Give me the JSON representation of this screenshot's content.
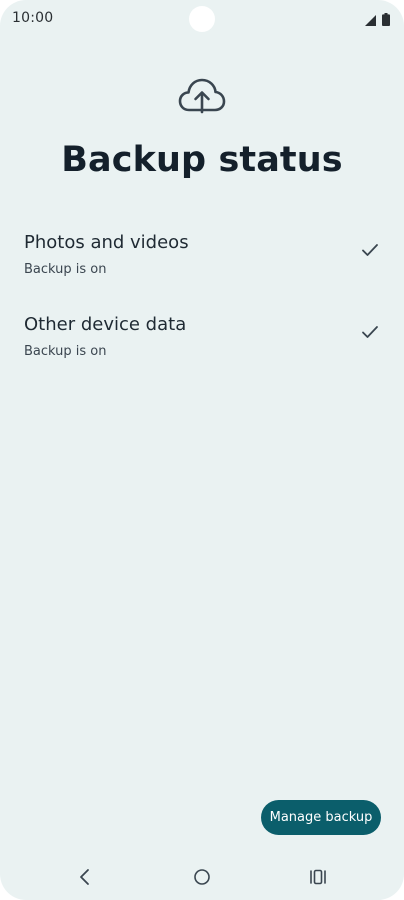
{
  "status_bar": {
    "time": "10:00",
    "icons": [
      "signal-icon",
      "battery-icon"
    ]
  },
  "header": {
    "icon": "cloud-upload-icon",
    "title": "Backup status"
  },
  "items": [
    {
      "title": "Photos and videos",
      "subtitle": "Backup is on",
      "icon": "check-icon"
    },
    {
      "title": "Other device data",
      "subtitle": "Backup is on",
      "icon": "check-icon"
    }
  ],
  "actions": {
    "manage_backup_label": "Manage backup"
  },
  "nav": {
    "buttons": [
      "back-icon",
      "home-icon",
      "recents-icon"
    ]
  },
  "colors": {
    "background": "#eaf2f2",
    "accent": "#0b5e6b",
    "title_text": "#14202b"
  }
}
